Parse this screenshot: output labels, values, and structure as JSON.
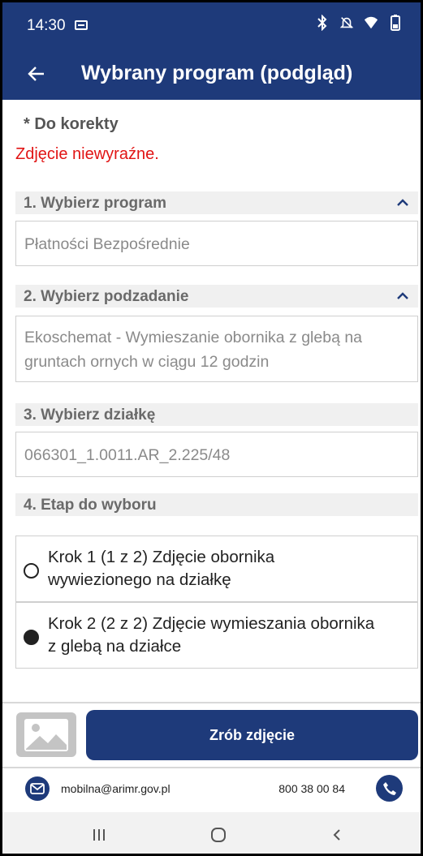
{
  "status_bar": {
    "time": "14:30"
  },
  "app_bar": {
    "title": "Wybrany program (podgląd)"
  },
  "correction": {
    "label": "* Do korekty",
    "message": "Zdjęcie niewyraźne."
  },
  "sections": {
    "program": {
      "title": "1. Wybierz program",
      "value": "Płatności Bezpośrednie"
    },
    "subtask": {
      "title": "2. Wybierz podzadanie",
      "value_line1": "Ekoschemat - Wymieszanie obornika z glebą na",
      "value_line2": "gruntach ornych w ciągu 12 godzin"
    },
    "plot": {
      "title": "3. Wybierz działkę",
      "value": "066301_1.0011.AR_2.225/48"
    },
    "stage": {
      "title": "4. Etap do wyboru",
      "options": [
        {
          "line1": "Krok 1 (1 z 2) Zdjęcie obornika",
          "line2": "wywiezionego na działkę",
          "selected": false
        },
        {
          "line1": "Krok 2 (2 z 2) Zdjęcie wymieszania obornika",
          "line2": "z glebą na działce",
          "selected": true
        }
      ]
    }
  },
  "actions": {
    "take_photo_label": "Zrób zdjęcie"
  },
  "footer": {
    "email": "mobilna@arimr.gov.pl",
    "phone": "800 38 00 84"
  },
  "colors": {
    "primary": "#1e3a7a",
    "error": "#e11414"
  },
  "icons": [
    "notification-icon",
    "bluetooth-icon",
    "mute-icon",
    "wifi-icon",
    "battery-icon",
    "back-arrow-icon",
    "chevron-up-icon",
    "image-icon",
    "mail-icon",
    "phone-icon",
    "recents-icon",
    "home-icon",
    "nav-back-icon"
  ]
}
